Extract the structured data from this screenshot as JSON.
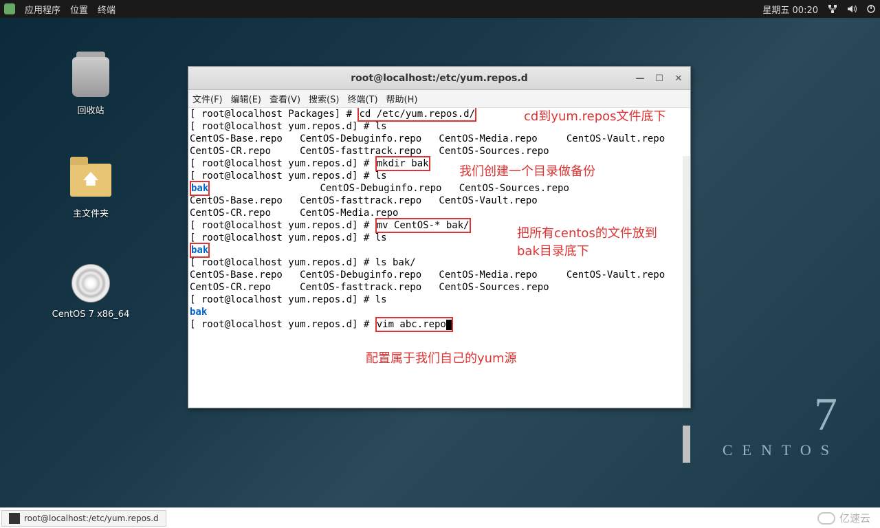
{
  "panel": {
    "apps": "应用程序",
    "places": "位置",
    "terminal": "终端",
    "clock": "星期五 00:20"
  },
  "desktop": {
    "trash": "回收站",
    "home": "主文件夹",
    "disc": "CentOS 7 x86_64"
  },
  "brand": {
    "seven": "7",
    "name": "CENTOS"
  },
  "window": {
    "title": "root@localhost:/etc/yum.repos.d",
    "menu": {
      "file": "文件(F)",
      "edit": "编辑(E)",
      "view": "查看(V)",
      "search": "搜索(S)",
      "terminal": "终端(T)",
      "help": "帮助(H)"
    }
  },
  "term": {
    "p_pkg": "[ root@localhost Packages] # ",
    "cmd_cd": "cd /etc/yum.repos.d/",
    "p": "[ root@localhost yum.repos.d] # ",
    "ls": "ls",
    "row_a": "CentOS-Base.repo   CentOS-Debuginfo.repo   CentOS-Media.repo     CentOS-Vault.repo",
    "row_b": "CentOS-CR.repo     CentOS-fasttrack.repo   CentOS-Sources.repo",
    "cmd_mkdir": "mkdir bak",
    "bak": "bak",
    "row_c": "                   CentOS-Debuginfo.repo   CentOS-Sources.repo",
    "row_d": "CentOS-Base.repo   CentOS-fasttrack.repo   CentOS-Vault.repo",
    "row_e": "CentOS-CR.repo     CentOS-Media.repo",
    "cmd_mv": "mv CentOS-* bak/",
    "ls_bak": "ls bak/",
    "cmd_vim": "vim abc.repo"
  },
  "anno": {
    "a1": "cd到yum.repos文件底下",
    "a2": "我们创建一个目录做备份",
    "a3a": "把所有centos的文件放到",
    "a3b": "bak目录底下",
    "a4": "配置属于我们自己的yum源"
  },
  "taskbar": {
    "item": "root@localhost:/etc/yum.repos.d"
  },
  "watermark": "亿速云"
}
